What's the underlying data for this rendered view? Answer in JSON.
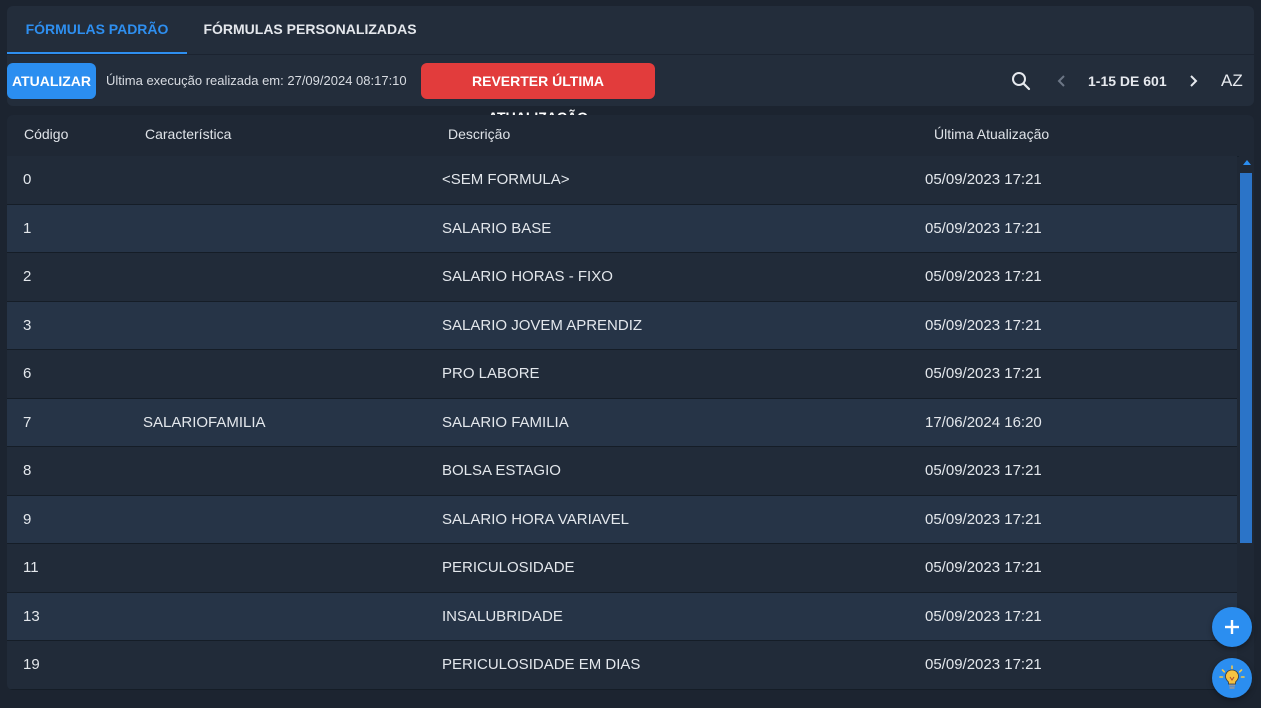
{
  "tabs": [
    {
      "label": "FÓRMULAS PADRÃO",
      "active": true
    },
    {
      "label": "FÓRMULAS PERSONALIZADAS",
      "active": false
    }
  ],
  "toolbar": {
    "update_label": "ATUALIZAR",
    "last_execution": "Última execução realizada em: 27/09/2024 08:17:10",
    "revert_label": "REVERTER ÚLTIMA ATUALIZAÇÃO",
    "pagination": "1-15 DE 601",
    "sort_label": "AZ"
  },
  "icons": {
    "search": "search-icon",
    "prev": "chevron-left-icon",
    "next": "chevron-right-icon",
    "sort": "sort-az-icon",
    "add": "plus-icon",
    "tip": "lightbulb-icon"
  },
  "colors": {
    "accent": "#2b8ef0",
    "danger": "#e23c3c"
  },
  "table": {
    "columns": [
      "Código",
      "Característica",
      "Descrição",
      "Última Atualização"
    ],
    "rows": [
      {
        "codigo": "0",
        "caracteristica": "",
        "descricao": "<SEM FORMULA>",
        "atualizacao": "05/09/2023 17:21"
      },
      {
        "codigo": "1",
        "caracteristica": "",
        "descricao": "SALARIO BASE",
        "atualizacao": "05/09/2023 17:21"
      },
      {
        "codigo": "2",
        "caracteristica": "",
        "descricao": "SALARIO HORAS - FIXO",
        "atualizacao": "05/09/2023 17:21"
      },
      {
        "codigo": "3",
        "caracteristica": "",
        "descricao": "SALARIO JOVEM APRENDIZ",
        "atualizacao": "05/09/2023 17:21"
      },
      {
        "codigo": "6",
        "caracteristica": "",
        "descricao": "PRO LABORE",
        "atualizacao": "05/09/2023 17:21"
      },
      {
        "codigo": "7",
        "caracteristica": "SALARIOFAMILIA",
        "descricao": "SALARIO FAMILIA",
        "atualizacao": "17/06/2024 16:20"
      },
      {
        "codigo": "8",
        "caracteristica": "",
        "descricao": "BOLSA ESTAGIO",
        "atualizacao": "05/09/2023 17:21"
      },
      {
        "codigo": "9",
        "caracteristica": "",
        "descricao": "SALARIO HORA VARIAVEL",
        "atualizacao": "05/09/2023 17:21"
      },
      {
        "codigo": "11",
        "caracteristica": "",
        "descricao": "PERICULOSIDADE",
        "atualizacao": "05/09/2023 17:21"
      },
      {
        "codigo": "13",
        "caracteristica": "",
        "descricao": "INSALUBRIDADE",
        "atualizacao": "05/09/2023 17:21"
      },
      {
        "codigo": "19",
        "caracteristica": "",
        "descricao": "PERICULOSIDADE EM DIAS",
        "atualizacao": "05/09/2023 17:21"
      }
    ]
  }
}
